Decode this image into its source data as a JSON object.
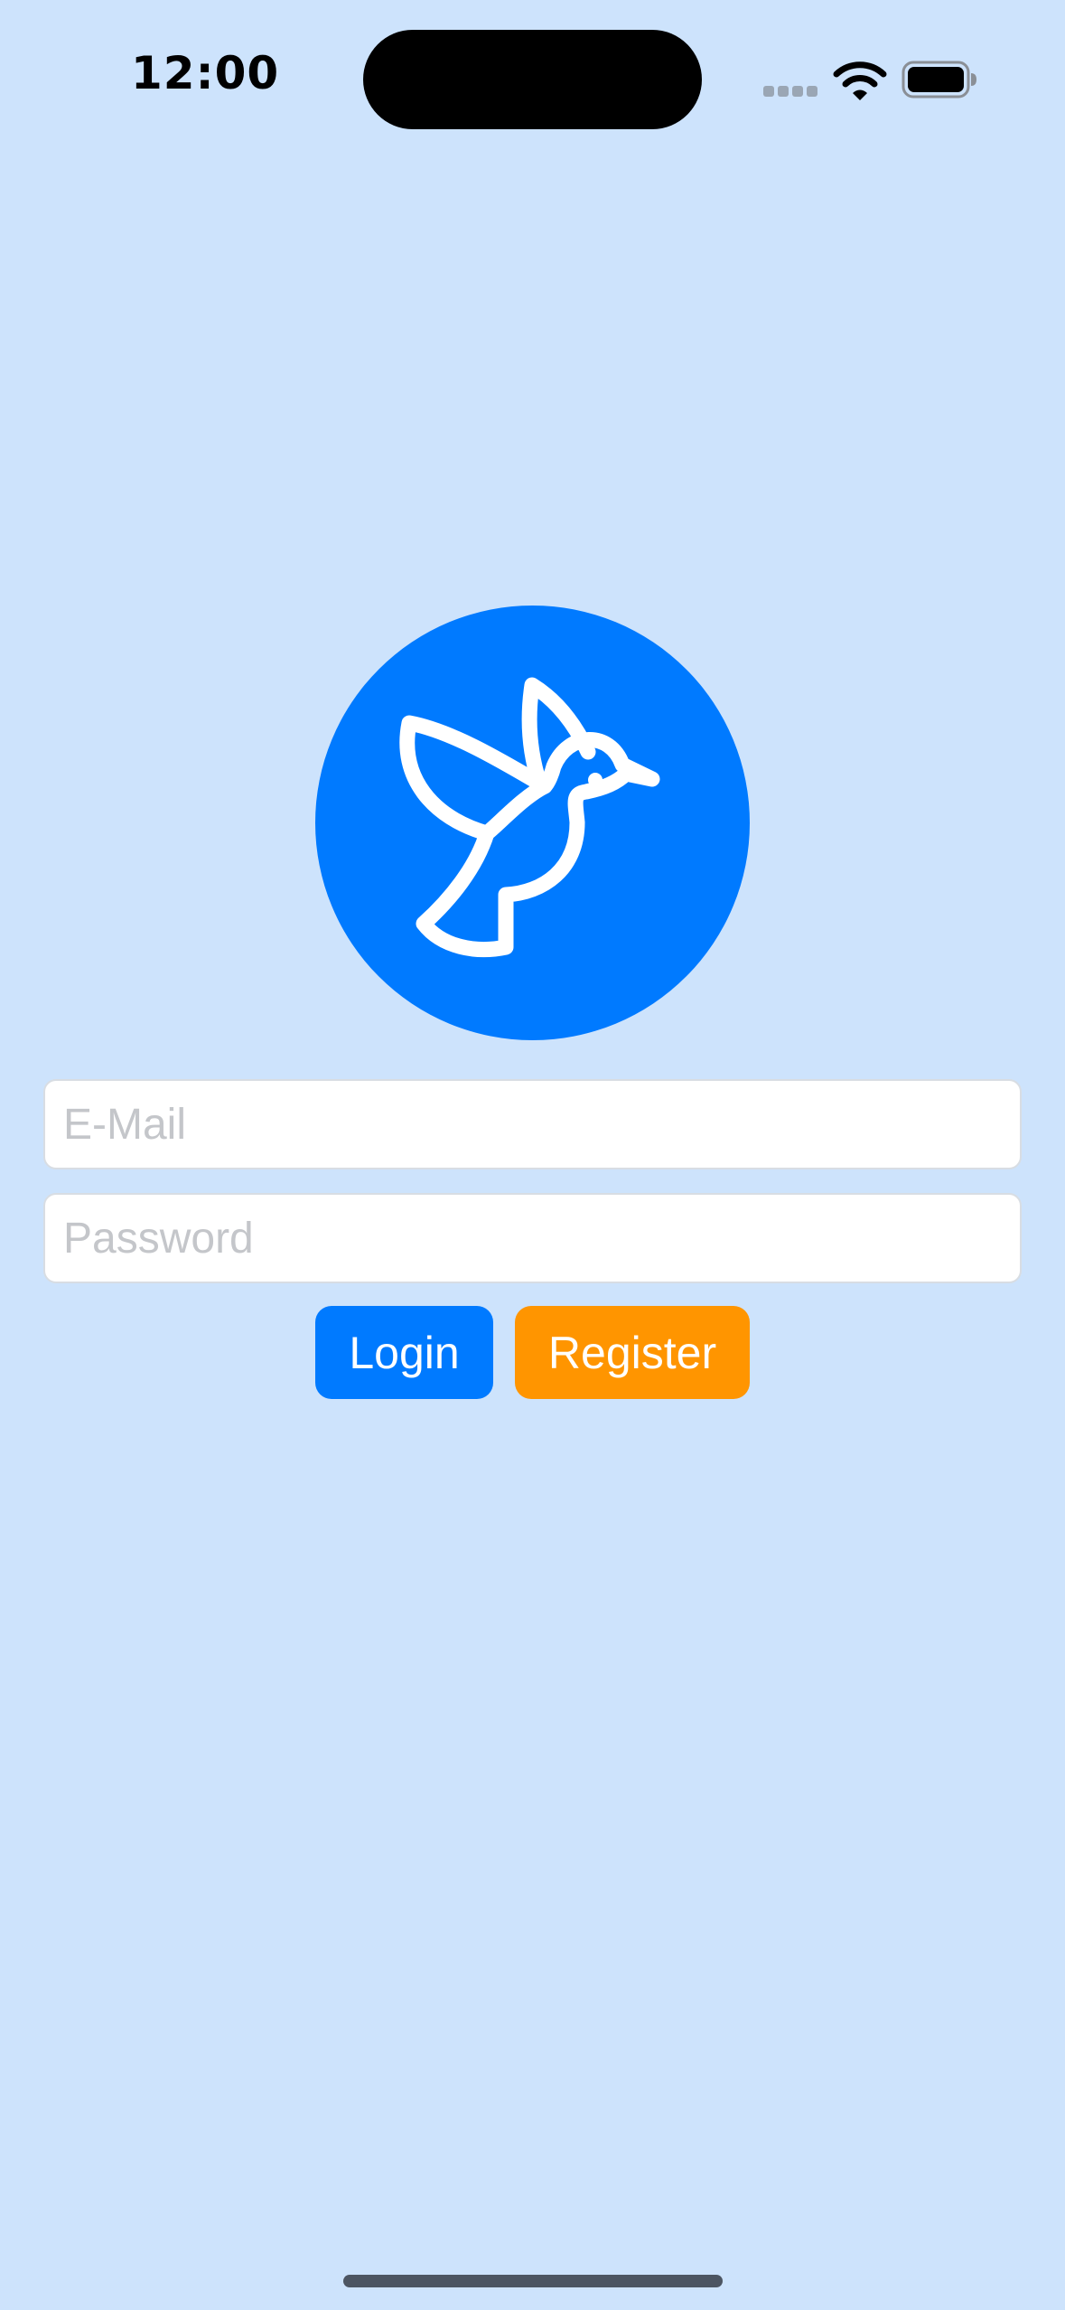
{
  "status_bar": {
    "time": "12:00",
    "icons": [
      "cellular-signal-icon",
      "wifi-icon",
      "battery-icon"
    ]
  },
  "logo": {
    "icon": "hummingbird-icon",
    "background_color": "#007aff",
    "icon_color": "#ffffff"
  },
  "form": {
    "email_placeholder": "E-Mail",
    "email_value": "",
    "password_placeholder": "Password",
    "password_value": ""
  },
  "buttons": {
    "login_label": "Login",
    "register_label": "Register",
    "login_color": "#007aff",
    "register_color": "#ff9500"
  },
  "theme": {
    "background": "#cde3fc"
  }
}
